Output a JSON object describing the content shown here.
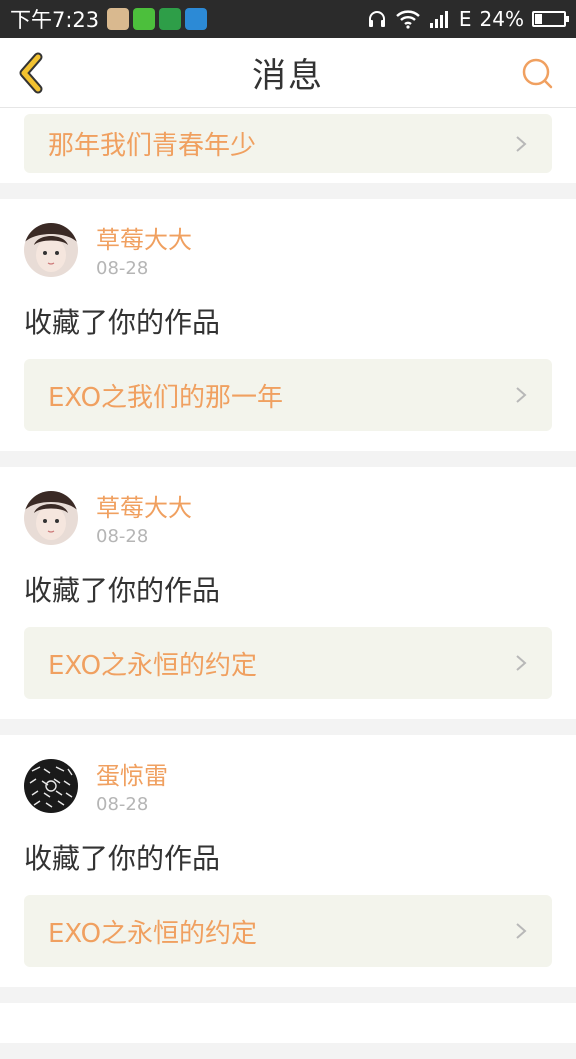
{
  "status_bar": {
    "time": "下午7:23",
    "network": "E",
    "battery": "24%"
  },
  "header": {
    "title": "消息",
    "back_icon": "chevron-left-icon",
    "search_icon": "search-icon"
  },
  "colors": {
    "accent": "#f0a060",
    "back_yellow": "#f2c230",
    "link_bg": "#f3f4ec"
  },
  "feed": {
    "partial_top": {
      "work_title": "那年我们青春年少"
    },
    "items": [
      {
        "user_name": "草莓大大",
        "date": "08-28",
        "action": "收藏了你的作品",
        "work_title": "EXO之我们的那一年"
      },
      {
        "user_name": "草莓大大",
        "date": "08-28",
        "action": "收藏了你的作品",
        "work_title": "EXO之永恒的约定"
      },
      {
        "user_name": "蛋惊雷",
        "date": "08-28",
        "action": "收藏了你的作品",
        "work_title": "EXO之永恒的约定"
      }
    ]
  }
}
